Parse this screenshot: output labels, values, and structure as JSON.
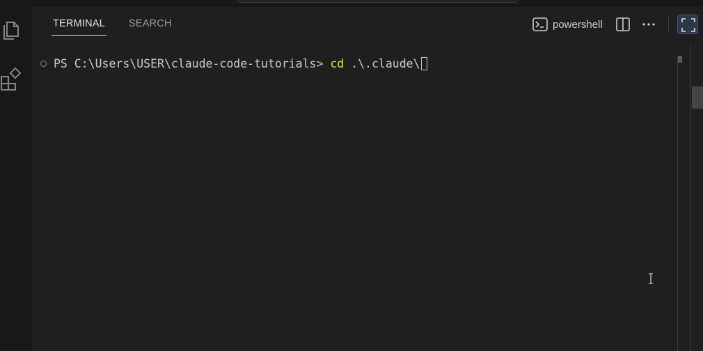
{
  "activity_bar": {
    "items": [
      {
        "icon": "files-icon",
        "label": "Explorer"
      },
      {
        "icon": "extensions-icon",
        "label": "Extensions"
      }
    ]
  },
  "panel": {
    "tabs": [
      {
        "label": "TERMINAL",
        "active": true
      },
      {
        "label": "SEARCH",
        "active": false
      }
    ],
    "toolbar": {
      "shell_label": "powershell",
      "shell_icon": "terminal-icon",
      "split_icon": "split-terminal-icon",
      "more_icon": "more-actions-icon",
      "maximize_icon": "maximize-panel-icon"
    }
  },
  "terminal": {
    "prompt": "PS C:\\Users\\USER\\claude-code-tutorials> ",
    "command": "cd",
    "argument": " .\\.claude\\"
  },
  "colors": {
    "background": "#1f1f1f",
    "command": "#e5e510",
    "text": "#cccccc",
    "accent": "#3d5a80"
  }
}
